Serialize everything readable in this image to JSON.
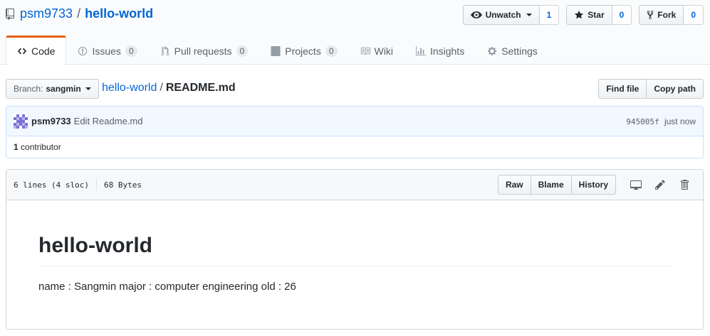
{
  "repo": {
    "owner": "psm9733",
    "separator": "/",
    "name": "hello-world"
  },
  "actions": {
    "watch_label": "Unwatch",
    "watch_count": "1",
    "star_label": "Star",
    "star_count": "0",
    "fork_label": "Fork",
    "fork_count": "0"
  },
  "nav": {
    "code": "Code",
    "issues": "Issues",
    "issues_count": "0",
    "pulls": "Pull requests",
    "pulls_count": "0",
    "projects": "Projects",
    "projects_count": "0",
    "wiki": "Wiki",
    "insights": "Insights",
    "settings": "Settings"
  },
  "file_nav": {
    "branch_prefix": "Branch:",
    "branch_name": "sangmin",
    "crumb_repo": "hello-world",
    "crumb_sep": "/",
    "crumb_file": "README.md",
    "find_file": "Find file",
    "copy_path": "Copy path"
  },
  "commit": {
    "author": "psm9733",
    "message": "Edit Readme.md",
    "sha": "945005f",
    "time": "just now",
    "contributors_count": "1",
    "contributors_label": "contributor"
  },
  "file": {
    "lines": "6 lines (4 sloc)",
    "size": "68 Bytes",
    "raw": "Raw",
    "blame": "Blame",
    "history": "History"
  },
  "readme": {
    "heading": "hello-world",
    "body": "name : Sangmin major : computer engineering old : 26"
  },
  "colors": {
    "link": "#0366d6",
    "selected_tab_accent": "#e36209",
    "commit_bg": "#f1f8ff"
  }
}
